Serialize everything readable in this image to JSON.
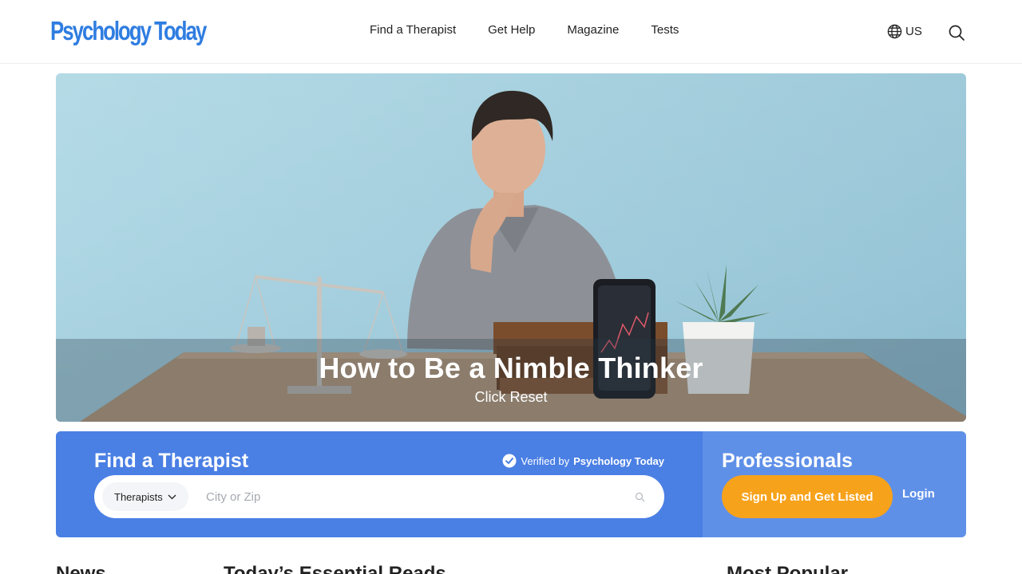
{
  "header": {
    "logo": "Psychology Today",
    "nav": [
      "Find a Therapist",
      "Get Help",
      "Magazine",
      "Tests"
    ],
    "locale": "US",
    "icons": {
      "locale": "globe-icon",
      "search": "search-icon"
    }
  },
  "hero": {
    "title": "How to Be a Nimble Thinker",
    "subtitle": "Click Reset"
  },
  "finder": {
    "title": "Find a Therapist",
    "verified_prefix": "Verified by",
    "verified_brand": "Psychology Today",
    "type_select": "Therapists",
    "city_placeholder": "City or Zip"
  },
  "professionals": {
    "title": "Professionals",
    "signup_label": "Sign Up and Get Listed",
    "login_label": "Login"
  },
  "sections": {
    "news": "News",
    "essential": "Today’s Essential Reads",
    "popular": "Most Popular"
  },
  "colors": {
    "brand_blue": "#2f7de1",
    "finder_blue": "#4a7fe4",
    "pros_blue": "#5f90e8",
    "cta_orange": "#f7a21b"
  }
}
